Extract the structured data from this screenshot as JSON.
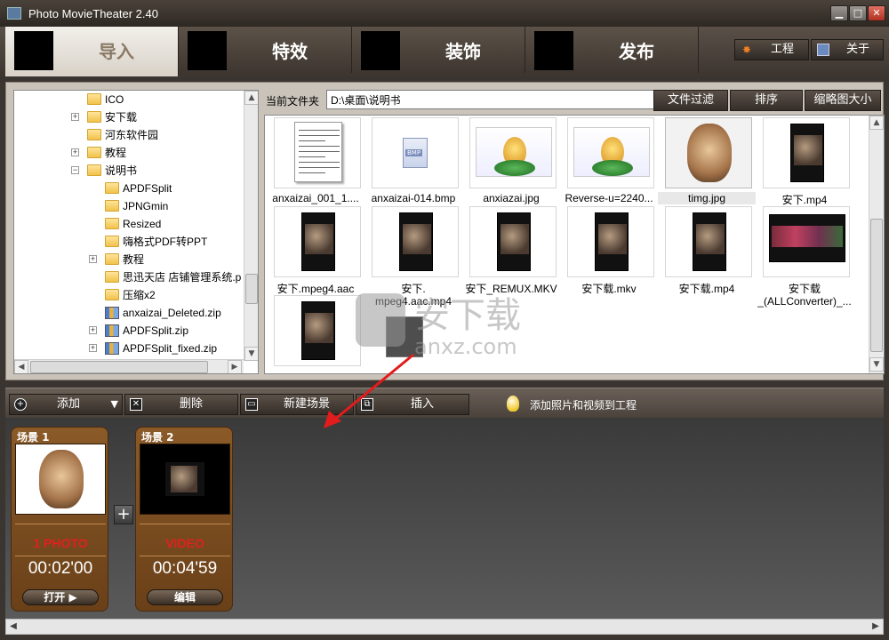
{
  "window": {
    "title": "Photo MovieTheater 2.40"
  },
  "tabs": [
    {
      "label": "导入",
      "active": true
    },
    {
      "label": "特效",
      "active": false
    },
    {
      "label": "装饰",
      "active": false
    },
    {
      "label": "发布",
      "active": false
    }
  ],
  "side_buttons": {
    "project": "工程",
    "about": "关于"
  },
  "tree": {
    "items": [
      {
        "label": "ICO",
        "icon": "folder-icon",
        "expand": false
      },
      {
        "label": "安下载",
        "icon": "folder-icon",
        "expand": true
      },
      {
        "label": "河东软件园",
        "icon": "folder-icon",
        "expand": false
      },
      {
        "label": "教程",
        "icon": "folder-icon",
        "expand": true
      },
      {
        "label": "说明书",
        "icon": "folder-icon",
        "expand": "open"
      },
      {
        "label": "APDFSplit",
        "icon": "folder-icon",
        "expand": false
      },
      {
        "label": "JPNGmin",
        "icon": "folder-icon",
        "expand": false
      },
      {
        "label": "Resized",
        "icon": "folder-icon",
        "expand": false
      },
      {
        "label": "嗨格式PDF转PPT",
        "icon": "folder-icon",
        "expand": false
      },
      {
        "label": "教程",
        "icon": "folder-icon",
        "expand": true
      },
      {
        "label": "思迅天店 店铺管理系统.p",
        "icon": "folder-icon",
        "expand": false
      },
      {
        "label": "压缩x2",
        "icon": "folder-icon",
        "expand": false
      },
      {
        "label": "anxaizai_Deleted.zip",
        "icon": "zip-icon",
        "expand": false
      },
      {
        "label": "APDFSplit.zip",
        "icon": "zip-icon",
        "expand": true
      },
      {
        "label": "APDFSplit_fixed.zip",
        "icon": "zip-icon",
        "expand": true
      }
    ]
  },
  "browser": {
    "folder_label": "当前文件夹",
    "path": "D:\\桌面\\说明书",
    "filter_btn": "文件过滤",
    "sort_btn": "排序",
    "thumbsize_btn": "缩略图大小",
    "files": [
      {
        "name": "anxaizai_001_1....",
        "kind": "doc"
      },
      {
        "name": "anxaizai-014.bmp",
        "kind": "bmp"
      },
      {
        "name": "anxiazai.jpg",
        "kind": "img"
      },
      {
        "name": "Reverse-u=2240...",
        "kind": "img"
      },
      {
        "name": "timg.jpg",
        "kind": "dog"
      },
      {
        "name": "安下.mp4",
        "kind": "video"
      },
      {
        "name": "安下.mpeg4.aac",
        "kind": "video"
      },
      {
        "name": "安下.",
        "name2": "mpeg4.aac.mp4",
        "kind": "video"
      },
      {
        "name": "安下_REMUX.MKV",
        "kind": "video"
      },
      {
        "name": "安下载.mkv",
        "kind": "video"
      },
      {
        "name": "安下载.mp4",
        "kind": "video"
      },
      {
        "name": "安下载",
        "name2": "_(ALLConverter)_...",
        "kind": "video-wide"
      },
      {
        "name": "",
        "kind": "video"
      }
    ]
  },
  "scene_toolbar": {
    "add": "添加",
    "delete": "删除",
    "new_scene": "新建场景",
    "insert": "插入",
    "hint": "添加照片和视频到工程"
  },
  "scenes": [
    {
      "name": "场景 1",
      "type": "1 PHOTO",
      "duration": "00:02'00",
      "button": "打开 ▶"
    },
    {
      "name": "场景 2",
      "type": "VIDEO",
      "duration": "00:04'59",
      "button": "编辑"
    }
  ],
  "colors": {
    "accent_red": "#e02020",
    "scene_brown": "#8a5a28",
    "title_bar": "#3a332d"
  }
}
